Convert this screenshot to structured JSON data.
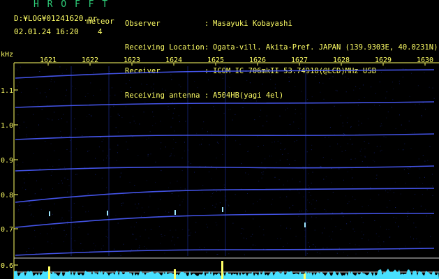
{
  "header": {
    "app_title": "H R O F F T",
    "file_path": "D:¥LOG¥01241620.pr",
    "meteor_label": "meteor",
    "datetime": "02.01.24 16:20",
    "meteor_count": "4"
  },
  "station": {
    "rows": [
      {
        "label": "Observer",
        "value": "Masayuki Kobayashi"
      },
      {
        "label": "Receiving Location",
        "value": "Ogata-vill. Akita-Pref. JAPAN (139.9303E, 40.0231N)"
      },
      {
        "label": "Receiver",
        "value": "ICOM IC-706mkII 53.74918(@LCD)MHz USB"
      },
      {
        "label": "Receiving antenna",
        "value": "A504HB(yagi 4el)"
      }
    ]
  },
  "spectrogram": {
    "y_unit": "kHz",
    "y_ticks": [
      "1.1",
      "1.0",
      "0.9",
      "0.8",
      "0.7",
      "0.6"
    ],
    "x_ticks": [
      "1621",
      "1622",
      "1623",
      "1624",
      "1625",
      "1626",
      "1627",
      "1628",
      "1629",
      "1630"
    ],
    "colors": {
      "axis": "#ffff66",
      "trace": "#4a5cff",
      "noise": "#1a2a90",
      "spectrum": "#48e0ff",
      "spike": "#ffff66",
      "baseline": "#d0d0d0"
    }
  }
}
